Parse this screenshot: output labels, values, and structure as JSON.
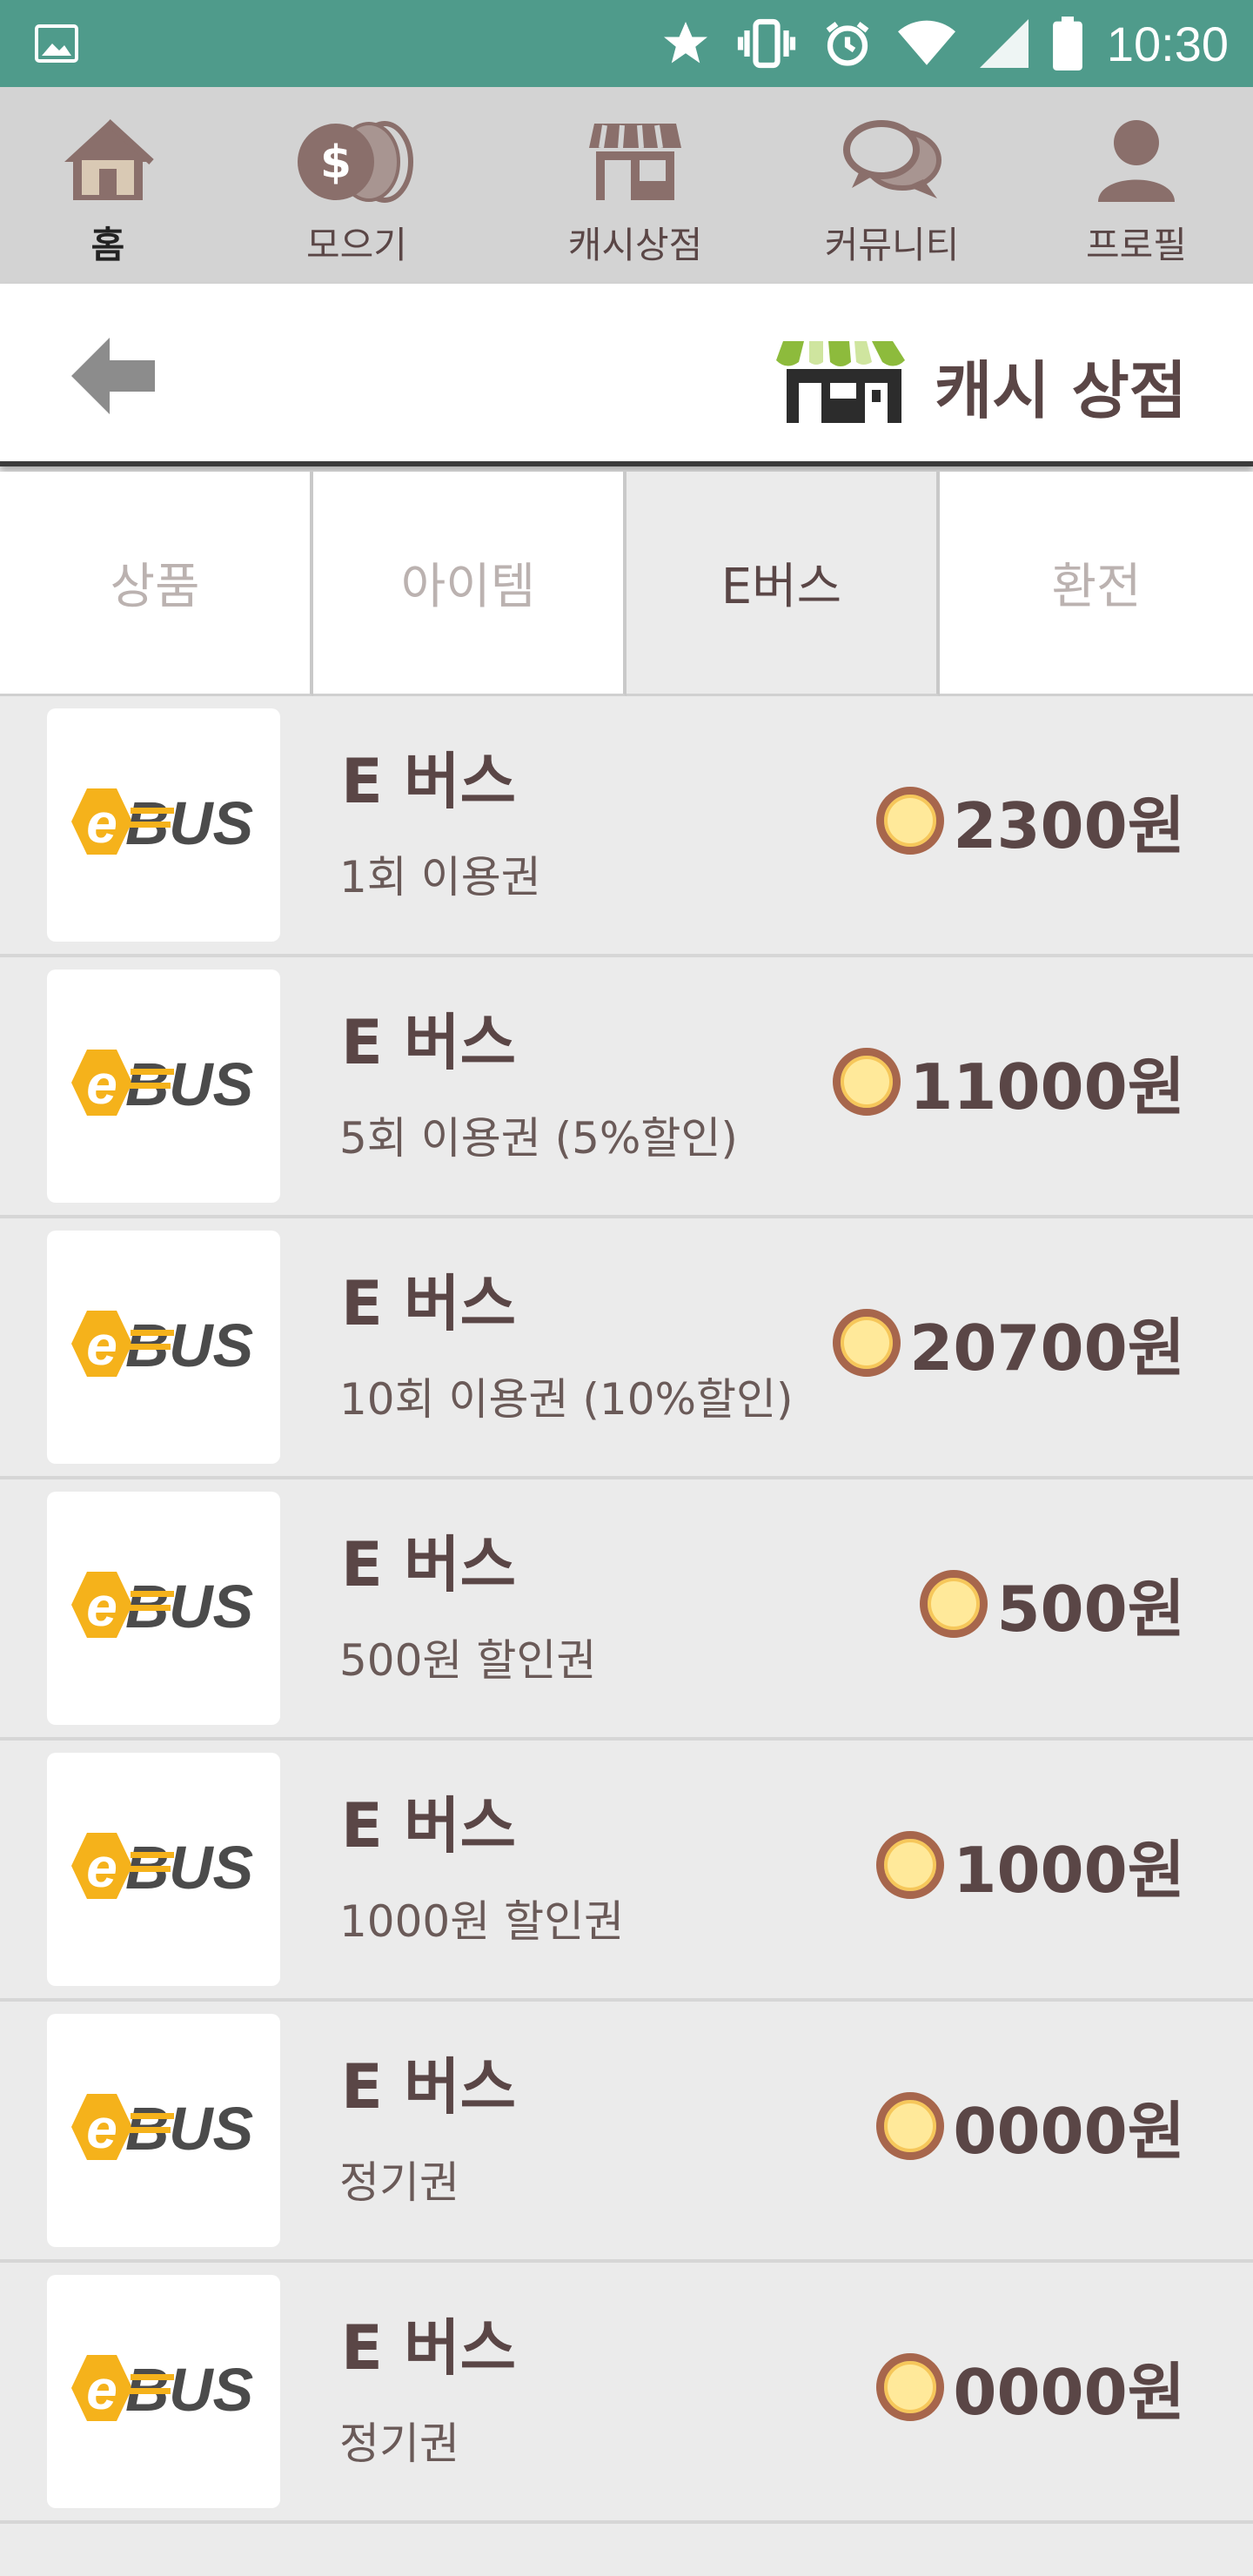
{
  "status_bar": {
    "time": "10:30",
    "icons": [
      "image-icon",
      "star-icon",
      "vibrate-icon",
      "alarm-icon",
      "wifi-icon",
      "signal-icon",
      "battery-icon"
    ]
  },
  "nav": {
    "items": [
      {
        "label": "홈",
        "icon": "home-icon",
        "active": true
      },
      {
        "label": "모으기",
        "icon": "coins-icon",
        "active": false
      },
      {
        "label": "캐시상점",
        "icon": "store-icon",
        "active": false
      },
      {
        "label": "커뮤니티",
        "icon": "chat-icon",
        "active": false
      },
      {
        "label": "프로필",
        "icon": "profile-icon",
        "active": false
      }
    ]
  },
  "header": {
    "title": "캐시 상점",
    "back_icon": "back-arrow-icon",
    "logo_icon": "store-awning-icon"
  },
  "tabs": [
    {
      "label": "상품",
      "active": false
    },
    {
      "label": "아이템",
      "active": false
    },
    {
      "label": "E버스",
      "active": true
    },
    {
      "label": "환전",
      "active": false
    }
  ],
  "products": [
    {
      "logo_text": "eBUS",
      "title": "E 버스",
      "subtitle": "1회 이용권",
      "price": "2300원"
    },
    {
      "logo_text": "eBUS",
      "title": "E 버스",
      "subtitle": "5회 이용권 (5%할인)",
      "price": "11000원"
    },
    {
      "logo_text": "eBUS",
      "title": "E 버스",
      "subtitle": "10회 이용권 (10%할인)",
      "price": "20700원"
    },
    {
      "logo_text": "eBUS",
      "title": "E 버스",
      "subtitle": "500원 할인권",
      "price": "500원"
    },
    {
      "logo_text": "eBUS",
      "title": "E 버스",
      "subtitle": "1000원 할인권",
      "price": "1000원"
    },
    {
      "logo_text": "eBUS",
      "title": "E 버스",
      "subtitle": "정기권",
      "price": "0000원"
    },
    {
      "logo_text": "eBUS",
      "title": "E 버스",
      "subtitle": "정기권",
      "price": "0000원"
    }
  ],
  "colors": {
    "status_bar": "#4f9b8b",
    "nav_bg": "#d3d3d3",
    "text_primary": "#5a4646",
    "coin_fill": "#ffe99a",
    "coin_ring": "#a7664c",
    "ebus_yellow": "#f5b21b",
    "awning_green": "#8dbb3c"
  }
}
